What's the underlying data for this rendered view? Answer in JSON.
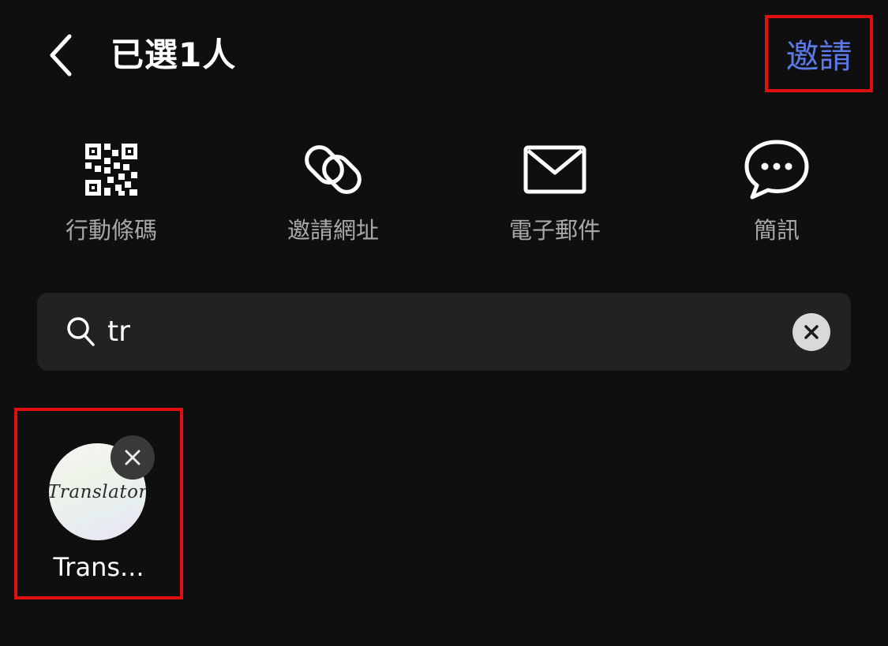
{
  "header": {
    "title": "已選1人",
    "invite_label": "邀請"
  },
  "share_options": [
    {
      "label": "行動條碼",
      "icon": "qr-code-icon"
    },
    {
      "label": "邀請網址",
      "icon": "link-icon"
    },
    {
      "label": "電子郵件",
      "icon": "mail-icon"
    },
    {
      "label": "簡訊",
      "icon": "chat-bubble-icon"
    }
  ],
  "search": {
    "value": "tr"
  },
  "selected": [
    {
      "name": "Trans...",
      "avatar_text": "Translator"
    }
  ],
  "colors": {
    "background": "#0f0f10",
    "accent": "#5b7ae8",
    "highlight_border": "#e01010",
    "muted_text": "#a8a8a8",
    "search_bg": "#222224"
  }
}
